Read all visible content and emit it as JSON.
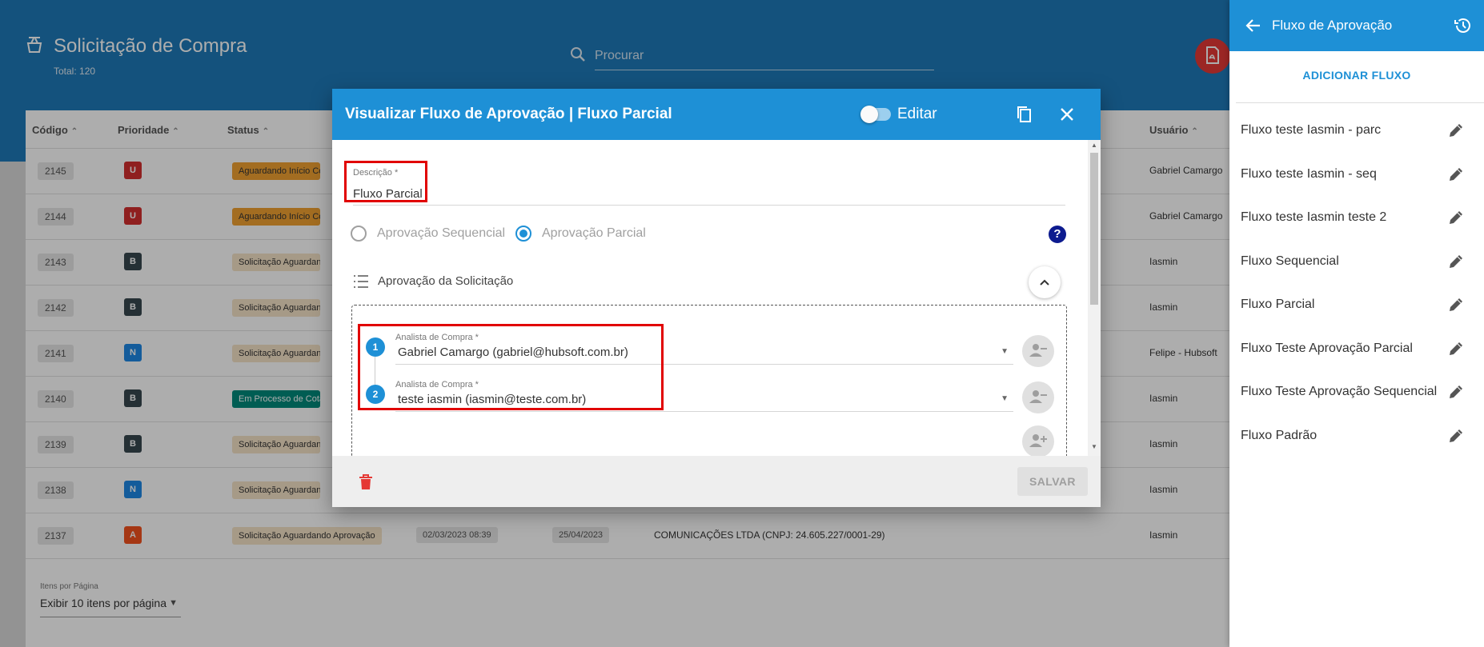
{
  "app": {
    "title": "Solicitação de Compra",
    "total": "Total: 120",
    "search_placeholder": "Procurar",
    "pdf_icon": "pdf-icon"
  },
  "table": {
    "columns": [
      "Código",
      "Prioridade",
      "Status",
      "Usuário"
    ],
    "rows": [
      {
        "code": "2145",
        "priority": "U",
        "priority_color": "#d32f2f",
        "status": "Aguardando Início Cotação",
        "status_color": "#f0a132",
        "status_text_color": "#333333",
        "user": "Gabriel Camargo"
      },
      {
        "code": "2144",
        "priority": "U",
        "priority_color": "#d32f2f",
        "status": "Aguardando Início Cotação",
        "status_color": "#f0a132",
        "status_text_color": "#333333",
        "user": "Gabriel Camargo"
      },
      {
        "code": "2143",
        "priority": "B",
        "priority_color": "#37474f",
        "status": "Solicitação Aguardando Aprovação",
        "status_color": "#f5e3c8",
        "status_text_color": "#333333",
        "user": "Iasmin"
      },
      {
        "code": "2142",
        "priority": "B",
        "priority_color": "#37474f",
        "status": "Solicitação Aguardando Aprovação",
        "status_color": "#f5e3c8",
        "status_text_color": "#333333",
        "user": "Iasmin"
      },
      {
        "code": "2141",
        "priority": "N",
        "priority_color": "#1e88e5",
        "status": "Solicitação Aguardando Aprovação",
        "status_color": "#f5e3c8",
        "status_text_color": "#333333",
        "user": "Felipe - Hubsoft"
      },
      {
        "code": "2140",
        "priority": "B",
        "priority_color": "#37474f",
        "status": "Em Processo de Cotação",
        "status_color": "#00897b",
        "status_text_color": "#ffffff",
        "user": "Iasmin"
      },
      {
        "code": "2139",
        "priority": "B",
        "priority_color": "#37474f",
        "status": "Solicitação Aguardando Aprovação",
        "status_color": "#f5e3c8",
        "status_text_color": "#333333",
        "user": "Iasmin"
      },
      {
        "code": "2138",
        "priority": "N",
        "priority_color": "#1e88e5",
        "status": "Solicitação Aguardando Aprovação",
        "status_color": "#f5e3c8",
        "status_text_color": "#333333",
        "user": "Iasmin"
      },
      {
        "code": "2137",
        "priority": "A",
        "priority_color": "#f4511e",
        "status": "Solicitação Aguardando Aprovação",
        "status_color": "#f5e3c8",
        "status_text_color": "#333333",
        "date1": "02/03/2023 08:39",
        "date2": "25/04/2023",
        "supplier": "COMUNICAÇÕES LTDA (CNPJ: 24.605.227/0001-29)",
        "user": "Iasmin"
      }
    ],
    "pager_label": "Itens por Página",
    "pager_value": "Exibir 10 itens por página"
  },
  "modal": {
    "title": "Visualizar Fluxo de Aprovação | Fluxo Parcial",
    "edit_label": "Editar",
    "edit_toggle_on": false,
    "description_label": "Descrição *",
    "description_value": "Fluxo Parcial",
    "radio_sequential": "Aprovação Sequencial",
    "radio_partial": "Aprovação Parcial",
    "selected_mode": "partial",
    "section_title": "Aprovação da Solicitação",
    "steps": [
      {
        "number": "1",
        "label": "Analista de Compra *",
        "value": "Gabriel Camargo (gabriel@hubsoft.com.br)"
      },
      {
        "number": "2",
        "label": "Analista de Compra *",
        "value": "teste iasmin (iasmin@teste.com.br)"
      }
    ],
    "save_label": "SALVAR"
  },
  "panel": {
    "title": "Fluxo de Aprovação",
    "add_label": "ADICIONAR FLUXO",
    "flows": [
      "Fluxo teste Iasmin - parc",
      "Fluxo teste Iasmin - seq",
      "Fluxo teste Iasmin teste 2",
      "Fluxo Sequencial",
      "Fluxo Parcial",
      "Fluxo Teste Aprovação Parcial",
      "Fluxo Teste Aprovação Sequencial",
      "Fluxo Padrão"
    ]
  },
  "colors": {
    "primary": "#1e90d6",
    "header_bg": "#1e7ab8",
    "highlight": "#e10000"
  }
}
